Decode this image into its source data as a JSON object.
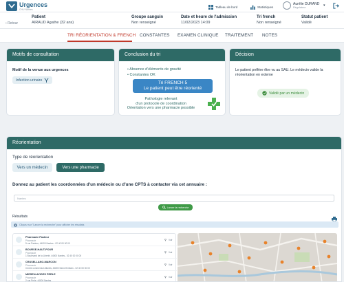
{
  "app": {
    "brand": "Urgences",
    "brand_sub": "CHU Nantes"
  },
  "topbar": {
    "dashboard_label": "Tableau de bord",
    "stats_label": "Statistiques",
    "user_name": "Aurélie DURAND",
    "user_role": "Régulateur",
    "user_caret": "▾"
  },
  "patient": {
    "back_label": "Retour",
    "patient_header": "Patient",
    "patient_value": "AIRAUD Agathe (32 ans)",
    "blood_header": "Groupe sanguin",
    "blood_value": "Non renseigné",
    "admission_header": "Date et heure de l'admission",
    "admission_value": "11/02/2023 14:09",
    "tri_header": "Tri french",
    "tri_value": "Non renseigné",
    "status_header": "Statut patient",
    "status_value": "Validé"
  },
  "tabs": [
    {
      "label": "TRI RÉORIENTATION & FRENCH",
      "active": true
    },
    {
      "label": "CONSTANTES",
      "active": false
    },
    {
      "label": "EXAMEN CLINIQUE",
      "active": false
    },
    {
      "label": "TRAITEMENT",
      "active": false
    },
    {
      "label": "NOTES",
      "active": false
    }
  ],
  "motifs": {
    "title": "Motifs de consultation",
    "label": "Motif de la venue aux urgences",
    "chip": "Infection urinaire"
  },
  "conclusion": {
    "title": "Conclusion du tri",
    "items": [
      "Absence d'éléments de gravité",
      "Constantes OK"
    ],
    "tri_line1": "Tri FRENCH 5",
    "tri_line2": "Le patient peut être réorienté",
    "patho_line1": "Pathologie relevant",
    "patho_line2": "d'un protocole de coordination",
    "patho_line3": "Orientation vers une pharmacie possible"
  },
  "decision": {
    "title": "Décision",
    "text": "Le patient préfère être vu au SAU. Le médecin valide la réorientation en externe",
    "chip": "Validé par un médecin"
  },
  "reorientation": {
    "title": "Réorientation",
    "type_label": "Type de réorientation",
    "btn_doctor": "Vers un médecin",
    "btn_pharmacy": "Vers une pharmacie",
    "instruction": "Donnez au patient les coordonnées d'un médecin ou d'une CPTS à contacter via cet annuaire :",
    "search_value": "Nantes",
    "launch_label": "Lancer la recherche",
    "results_label": "Résultats",
    "info_text": "Cliquez sur \"Lancer la recherche\" pour afficher les résultats",
    "results": [
      {
        "name": "Pharmacie Pasteur",
        "type": "Pharmacie",
        "addr": "5 rue Pasteur, 44000 Nantes - 02 40 00 00 00",
        "voir": "Voir"
      },
      {
        "name": "BOURSE-HAUT-POUR",
        "type": "Pharmacie",
        "addr": "1 Boulevard de la Liberté, 44000 Nantes - 02 40 00 00 00",
        "voir": "Voir"
      },
      {
        "name": "CRUSELLANO-MARCON",
        "type": "Pharmacie",
        "addr": "Centre commercial Atlantis, 44800 Saint-Herblain - 02 40 00 00 00",
        "voir": "Voir"
      },
      {
        "name": "MIESEN-AVIGES PERLE",
        "type": "Pharmacie",
        "addr": "2 rue Perle, 44000 Nantes",
        "voir": "Voir"
      }
    ]
  },
  "colors": {
    "teal": "#2e6a66",
    "accent_red": "#c0392b",
    "tri_blue": "#3a86c5",
    "green": "#3f9a47"
  }
}
